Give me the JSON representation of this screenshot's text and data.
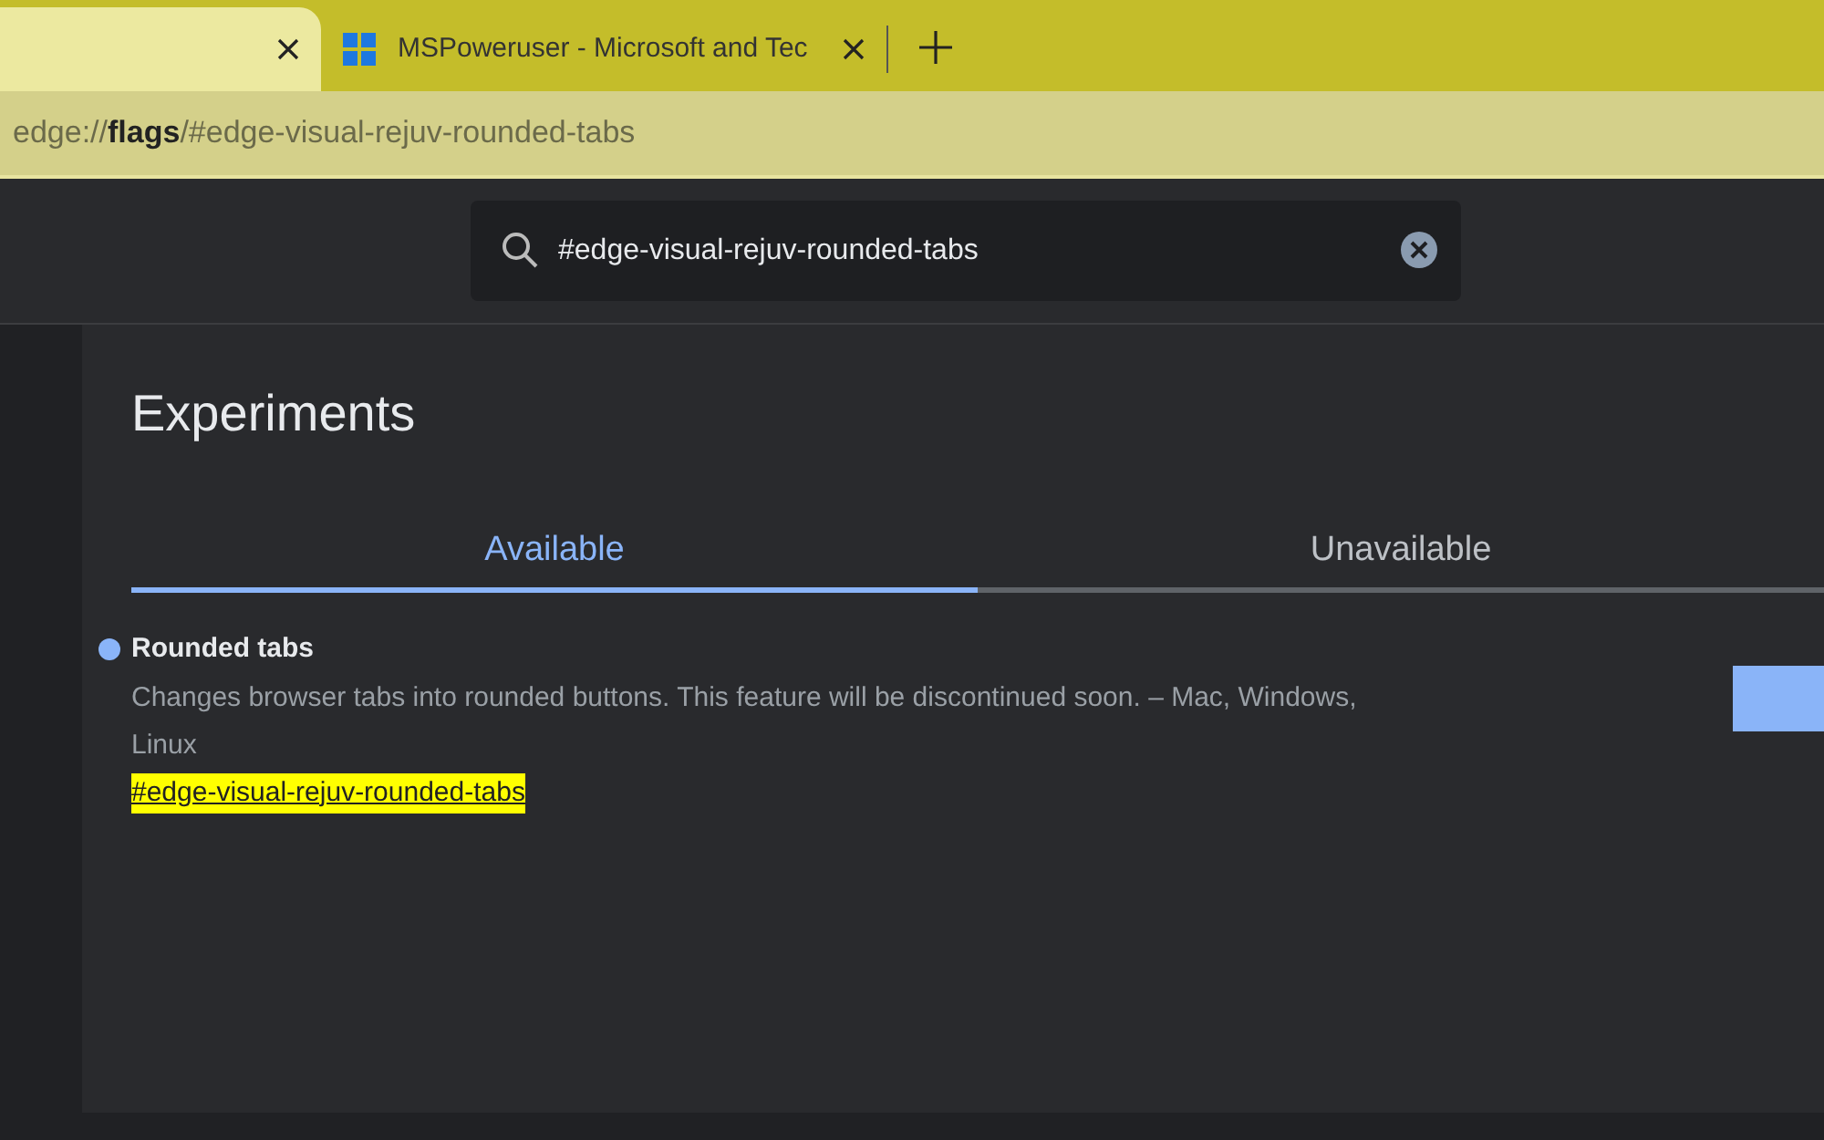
{
  "tabs": [
    {
      "selected": true
    },
    {
      "title": "MSPoweruser - Microsoft and Tec",
      "selected": false
    }
  ],
  "address_bar": {
    "url": "edge://**flags**/#edge-visual-rejuv-rounded-tabs"
  },
  "search": {
    "value": "#edge-visual-rejuv-rounded-tabs"
  },
  "page": {
    "title": "Experiments"
  },
  "section_tabs": [
    {
      "label": "Available",
      "selected": true
    },
    {
      "label": "Unavailable",
      "selected": false
    }
  ],
  "experiments": [
    {
      "name": "Rounded tabs",
      "modified": true,
      "description": "Changes browser tabs into rounded buttons. This feature will be discontinued soon. – Mac, Windows, Linux",
      "link": "#edge-visual-rejuv-rounded-tabs",
      "highlighted": true
    }
  ]
}
